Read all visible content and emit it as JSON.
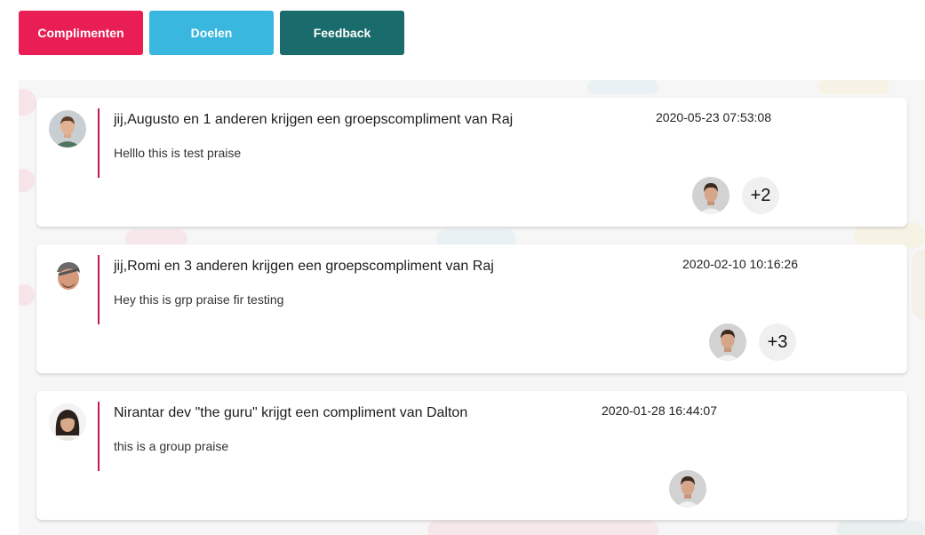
{
  "tabs": [
    {
      "label": "Complimenten",
      "color": "#e91e55"
    },
    {
      "label": "Doelen",
      "color": "#3ab7de"
    },
    {
      "label": "Feedback",
      "color": "#1a6b6b"
    }
  ],
  "feed": [
    {
      "title": "jij,Augusto en 1 anderen krijgen een groepscompliment van Raj",
      "timestamp": "2020-05-23 07:53:08",
      "message": "Helllo this is test praise",
      "more": "+2"
    },
    {
      "title": "jij,Romi en 3 anderen krijgen een groepscompliment van Raj",
      "timestamp": "2020-02-10 10:16:26",
      "message": "Hey this is grp praise fir testing",
      "more": "+3"
    },
    {
      "title": "Nirantar dev \"the guru\" krijgt een compliment van Dalton",
      "timestamp": "2020-01-28 16:44:07",
      "message": "this is a group praise",
      "more": ""
    }
  ],
  "colors": {
    "accent_line": "#c2185b",
    "feed_background": "#f6f6f6"
  }
}
